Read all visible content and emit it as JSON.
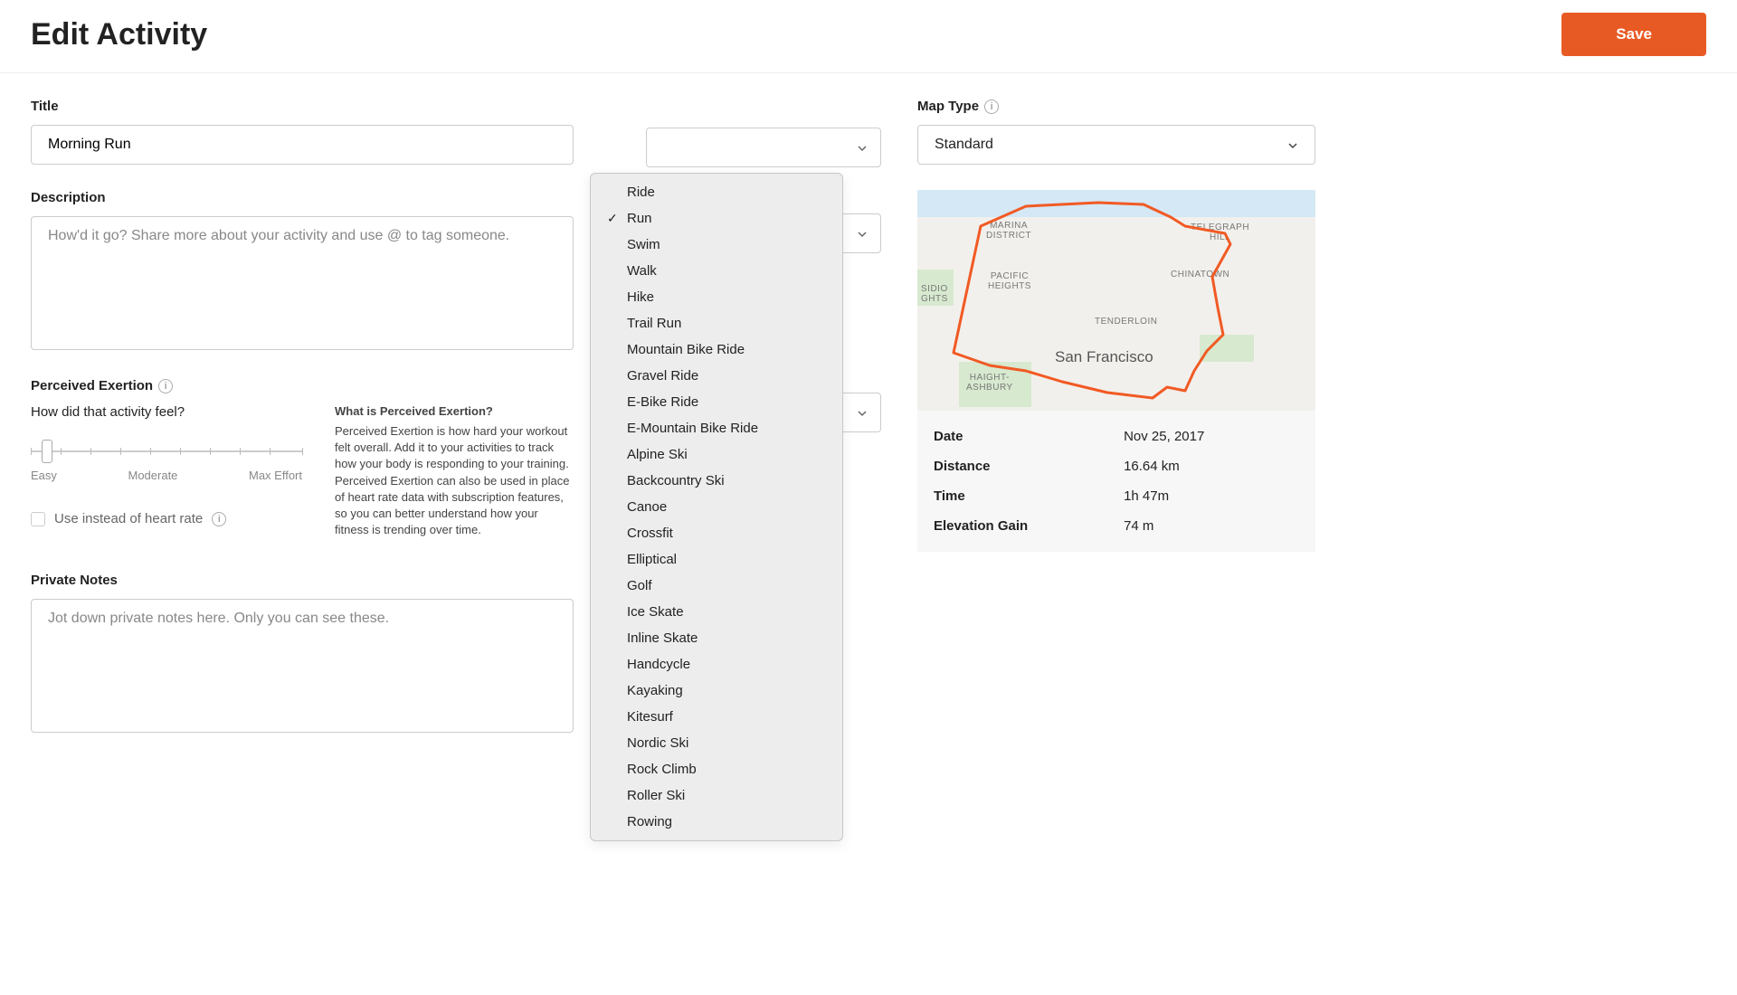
{
  "header": {
    "title": "Edit Activity",
    "save_label": "Save"
  },
  "left": {
    "title_label": "Title",
    "title_value": "Morning Run",
    "description_label": "Description",
    "description_placeholder": "How'd it go? Share more about your activity and use @ to tag someone.",
    "exertion_label": "Perceived Exertion",
    "exertion_question": "How did that activity feel?",
    "slider_labels": {
      "min": "Easy",
      "mid": "Moderate",
      "max": "Max Effort"
    },
    "hr_checkbox_label": "Use instead of heart rate",
    "exertion_info_heading": "What is Perceived Exertion?",
    "exertion_info_body": "Perceived Exertion is how hard your workout felt overall. Add it to your activities to track how your body is responding to your training. Perceived Exertion can also be used in place of heart rate data with subscription features, so you can better understand how your fitness is trending over time.",
    "private_notes_label": "Private Notes",
    "private_notes_placeholder": "Jot down private notes here. Only you can see these."
  },
  "sport_dropdown": {
    "selected": "Run",
    "options": [
      "Ride",
      "Run",
      "Swim",
      "Walk",
      "Hike",
      "Trail Run",
      "Mountain Bike Ride",
      "Gravel Ride",
      "E-Bike Ride",
      "E-Mountain Bike Ride",
      "Alpine Ski",
      "Backcountry Ski",
      "Canoe",
      "Crossfit",
      "Elliptical",
      "Golf",
      "Ice Skate",
      "Inline Skate",
      "Handcycle",
      "Kayaking",
      "Kitesurf",
      "Nordic Ski",
      "Rock Climb",
      "Roller Ski",
      "Rowing"
    ]
  },
  "right": {
    "map_type_label": "Map Type",
    "map_type_value": "Standard",
    "map_labels": {
      "marina": "MARINA\nDISTRICT",
      "telegraph": "TELEGRAPH\nHILL",
      "pacific": "PACIFIC\nHEIGHTS",
      "chinatown": "CHINATOWN",
      "tenderloin": "TENDERLOIN",
      "sidio": "SIDIO\nGHTS",
      "haight": "HAIGHT-\nASHBURY",
      "city": "San Francisco"
    },
    "stats": [
      {
        "k": "Date",
        "v": "Nov 25, 2017"
      },
      {
        "k": "Distance",
        "v": "16.64 km"
      },
      {
        "k": "Time",
        "v": "1h 47m"
      },
      {
        "k": "Elevation Gain",
        "v": "74 m"
      }
    ]
  }
}
